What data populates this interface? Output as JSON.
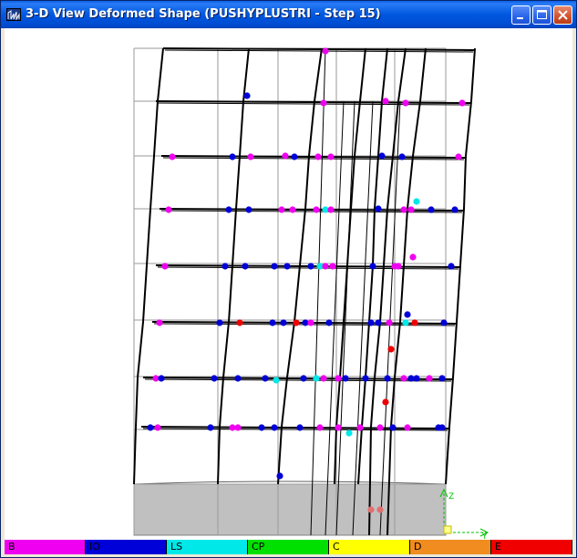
{
  "window": {
    "title": "3-D View  Deformed Shape (PUSHYPLUSTRI - Step 15)",
    "controls": [
      "minimize",
      "maximize",
      "close"
    ]
  },
  "view": {
    "axis_labels": {
      "z": "Z",
      "y": "Y"
    },
    "colors": {
      "frame": "#000000",
      "grid": "#9a9a9a",
      "foundation": "#c0c0c0",
      "axis": "#00c000"
    }
  },
  "legend": [
    {
      "label": "B",
      "color": "#f000f0"
    },
    {
      "label": "IO",
      "color": "#0000d8"
    },
    {
      "label": "LS",
      "color": "#00e8e8"
    },
    {
      "label": "CP",
      "color": "#00e000"
    },
    {
      "label": "C",
      "color": "#ffff00"
    },
    {
      "label": "D",
      "color": "#f08c20"
    },
    {
      "label": "E",
      "color": "#f00000"
    }
  ]
}
